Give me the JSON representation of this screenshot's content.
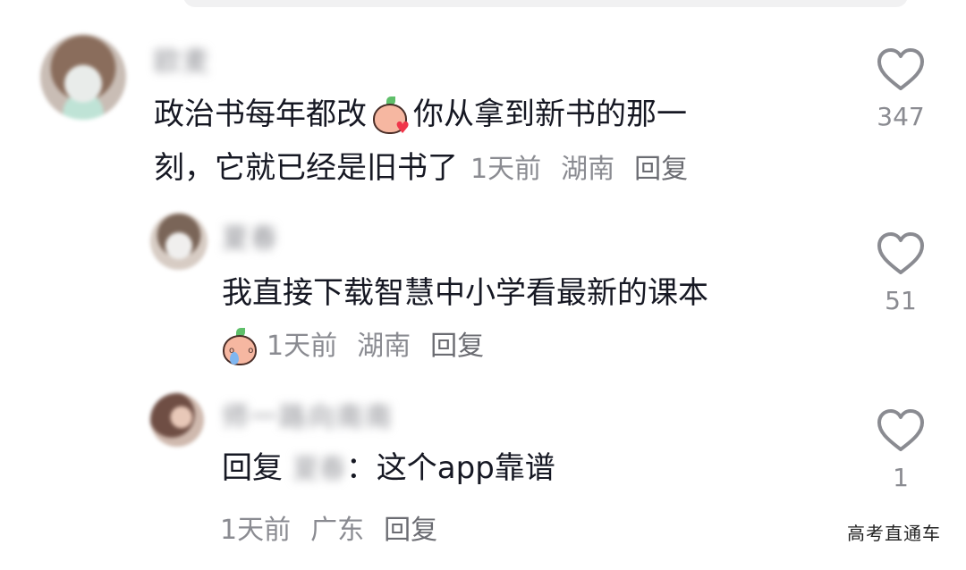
{
  "comments": [
    {
      "username": "欧麦",
      "text_line1": "政治书每年都改",
      "emoji": "blush-heart-emoji",
      "text_line1b": "你从拿到新书的那一",
      "text_line2": "刻，它就已经是旧书了",
      "time": "1天前",
      "location": "湖南",
      "reply": "回复",
      "likes": "347"
    },
    {
      "username": "夏春",
      "text_line1": "我直接下载智慧中小学看最新的课本",
      "emoji": "sweat-smile-emoji",
      "time": "1天前",
      "location": "湖南",
      "reply": "回复",
      "likes": "51"
    },
    {
      "username": "师一路向南南",
      "reply_prefix": "回复",
      "reply_to": "夏春",
      "text_line1": "：这个app靠谱",
      "time": "1天前",
      "location": "广东",
      "reply": "回复",
      "likes": "1"
    }
  ],
  "watermark": "高考直通车",
  "colors": {
    "text": "#161823",
    "meta": "#8a8b91",
    "like_icon": "#8a8b91"
  }
}
